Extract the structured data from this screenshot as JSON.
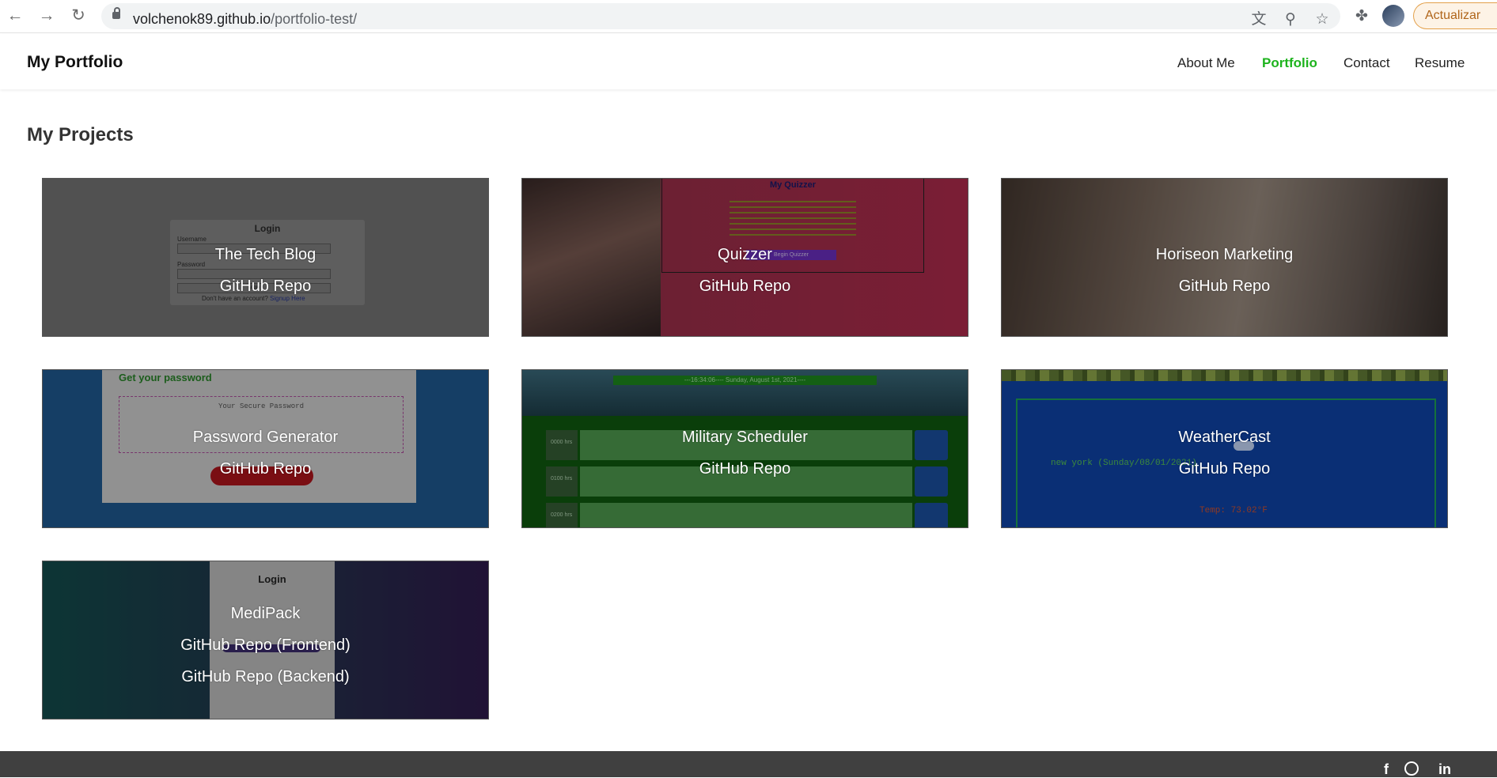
{
  "browser": {
    "url_host": "volchenok89.github.io",
    "url_path": "/portfolio-test/",
    "update_label": "Actualizar"
  },
  "site": {
    "brand": "My Portfolio",
    "nav": [
      "About Me",
      "Portfolio",
      "Contact",
      "Resume"
    ],
    "active_nav": "Portfolio",
    "accent_color": "#1db31d"
  },
  "main": {
    "section_title": "My Projects",
    "projects": [
      {
        "title": "The Tech Blog",
        "links": [
          "GitHub Repo"
        ]
      },
      {
        "title": "Quizzer",
        "links": [
          "GitHub Repo"
        ]
      },
      {
        "title": "Horiseon Marketing",
        "links": [
          "GitHub Repo"
        ]
      },
      {
        "title": "Password Generator",
        "links": [
          "GitHub Repo"
        ]
      },
      {
        "title": "Military Scheduler",
        "links": [
          "GitHub Repo"
        ]
      },
      {
        "title": "WeatherCast",
        "links": [
          "GitHub Repo"
        ]
      },
      {
        "title": "MediPack",
        "links": [
          "GitHub Repo (Frontend)",
          "GitHub Repo (Backend)"
        ]
      }
    ],
    "thumbnails": {
      "techblog": {
        "heading": "Login",
        "username_label": "Username",
        "password_label": "Password",
        "button": "Login",
        "signup_prompt": "Don't have an account?",
        "signup_link": "Signup Here"
      },
      "quizzer": {
        "heading": "My Quizzer",
        "button": "Begin Quizzer"
      },
      "password": {
        "heading": "Get your password",
        "placeholder": "Your Secure Password"
      },
      "military": {
        "banner": "---16:34:06---- Sunday, August 1st, 2021----",
        "hours": [
          "0000 hrs",
          "0100 hrs",
          "0200 hrs"
        ]
      },
      "weather": {
        "location": "new york (Sunday/08/01/2021)",
        "temp": "Temp: 73.02°F"
      },
      "medipack": {
        "heading": "Login"
      }
    }
  },
  "footer": {
    "social_icons": [
      "facebook-icon",
      "github-icon",
      "linkedin-icon"
    ]
  }
}
